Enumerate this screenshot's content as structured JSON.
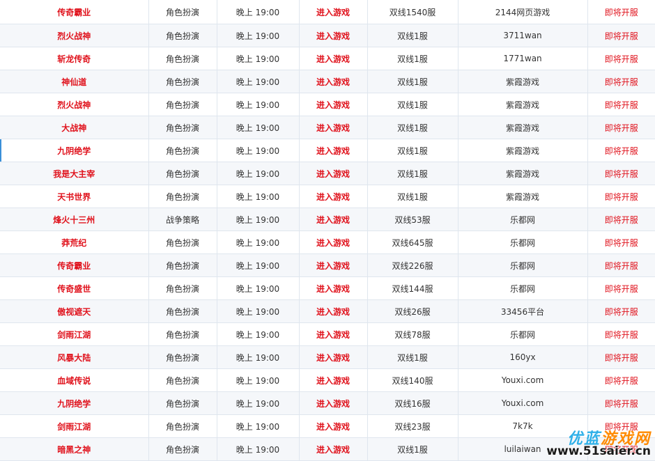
{
  "rows": [
    {
      "name": "传奇霸业",
      "type": "角色扮演",
      "time": "晚上 19:00",
      "enter": "进入游戏",
      "server": "双线1540服",
      "platform": "2144网页游戏",
      "status": "即将开服"
    },
    {
      "name": "烈火战神",
      "type": "角色扮演",
      "time": "晚上 19:00",
      "enter": "进入游戏",
      "server": "双线1服",
      "platform": "3711wan",
      "status": "即将开服"
    },
    {
      "name": "斩龙传奇",
      "type": "角色扮演",
      "time": "晚上 19:00",
      "enter": "进入游戏",
      "server": "双线1服",
      "platform": "1771wan",
      "status": "即将开服"
    },
    {
      "name": "神仙道",
      "type": "角色扮演",
      "time": "晚上 19:00",
      "enter": "进入游戏",
      "server": "双线1服",
      "platform": "紫霞游戏",
      "status": "即将开服"
    },
    {
      "name": "烈火战神",
      "type": "角色扮演",
      "time": "晚上 19:00",
      "enter": "进入游戏",
      "server": "双线1服",
      "platform": "紫霞游戏",
      "status": "即将开服"
    },
    {
      "name": "大战神",
      "type": "角色扮演",
      "time": "晚上 19:00",
      "enter": "进入游戏",
      "server": "双线1服",
      "platform": "紫霞游戏",
      "status": "即将开服"
    },
    {
      "name": "九阴绝学",
      "type": "角色扮演",
      "time": "晚上 19:00",
      "enter": "进入游戏",
      "server": "双线1服",
      "platform": "紫霞游戏",
      "status": "即将开服"
    },
    {
      "name": "我是大主宰",
      "type": "角色扮演",
      "time": "晚上 19:00",
      "enter": "进入游戏",
      "server": "双线1服",
      "platform": "紫霞游戏",
      "status": "即将开服"
    },
    {
      "name": "天书世界",
      "type": "角色扮演",
      "time": "晚上 19:00",
      "enter": "进入游戏",
      "server": "双线1服",
      "platform": "紫霞游戏",
      "status": "即将开服"
    },
    {
      "name": "烽火十三州",
      "type": "战争策略",
      "time": "晚上 19:00",
      "enter": "进入游戏",
      "server": "双线53服",
      "platform": "乐都网",
      "status": "即将开服"
    },
    {
      "name": "莽荒纪",
      "type": "角色扮演",
      "time": "晚上 19:00",
      "enter": "进入游戏",
      "server": "双线645服",
      "platform": "乐都网",
      "status": "即将开服"
    },
    {
      "name": "传奇霸业",
      "type": "角色扮演",
      "time": "晚上 19:00",
      "enter": "进入游戏",
      "server": "双线226服",
      "platform": "乐都网",
      "status": "即将开服"
    },
    {
      "name": "传奇盛世",
      "type": "角色扮演",
      "time": "晚上 19:00",
      "enter": "进入游戏",
      "server": "双线144服",
      "platform": "乐都网",
      "status": "即将开服"
    },
    {
      "name": "傲视遮天",
      "type": "角色扮演",
      "time": "晚上 19:00",
      "enter": "进入游戏",
      "server": "双线26服",
      "platform": "33456平台",
      "status": "即将开服"
    },
    {
      "name": "剑雨江湖",
      "type": "角色扮演",
      "time": "晚上 19:00",
      "enter": "进入游戏",
      "server": "双线78服",
      "platform": "乐都网",
      "status": "即将开服"
    },
    {
      "name": "风暴大陆",
      "type": "角色扮演",
      "time": "晚上 19:00",
      "enter": "进入游戏",
      "server": "双线1服",
      "platform": "160yx",
      "status": "即将开服"
    },
    {
      "name": "血域传说",
      "type": "角色扮演",
      "time": "晚上 19:00",
      "enter": "进入游戏",
      "server": "双线140服",
      "platform": "Youxi.com",
      "status": "即将开服"
    },
    {
      "name": "九阴绝学",
      "type": "角色扮演",
      "time": "晚上 19:00",
      "enter": "进入游戏",
      "server": "双线16服",
      "platform": "Youxi.com",
      "status": "即将开服"
    },
    {
      "name": "剑雨江湖",
      "type": "角色扮演",
      "time": "晚上 19:00",
      "enter": "进入游戏",
      "server": "双线23服",
      "platform": "7k7k",
      "status": "即将开服"
    },
    {
      "name": "暗黑之神",
      "type": "角色扮演",
      "time": "晚上 19:00",
      "enter": "进入游戏",
      "server": "双线1服",
      "platform": "luilaiwan",
      "status": "即将开服"
    }
  ],
  "watermark": {
    "logo_part1": "优蓝",
    "logo_part2": "游戏网",
    "url": "www.51saier.cn"
  },
  "colors": {
    "accent_red": "#e0121c",
    "border": "#dfe6ee",
    "stripe": "#f5f7fa",
    "logo_blue": "#2fb0e8",
    "logo_orange": "#ff8a00"
  }
}
